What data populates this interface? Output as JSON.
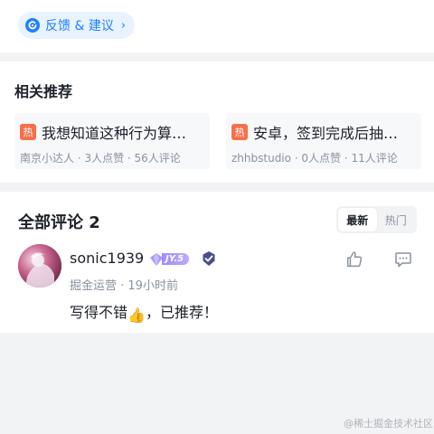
{
  "feedback": {
    "label": "反馈 & 建议",
    "chevron": "›",
    "icon": "feedback-icon"
  },
  "recommend": {
    "title": "相关推荐",
    "items": [
      {
        "badge": "热",
        "title": "我想知道这种行为算…",
        "meta": "南京小达人 · 3人点赞 · 56人评论"
      },
      {
        "badge": "热",
        "title": "安卓，签到完成后抽…",
        "meta": "zhhbstudio · 0人点赞 · 11人评论"
      }
    ]
  },
  "comments": {
    "title": "全部评论 2",
    "sort": {
      "options": [
        "最新",
        "热门"
      ],
      "selected": "最新"
    },
    "list": [
      {
        "user": "sonic1939",
        "level": "JY.5",
        "meta": "掘金运营 · 19小时前",
        "text_before": "写得不错",
        "emoji": "👍",
        "text_after": "，已推荐！"
      }
    ]
  },
  "watermark": "@稀土掘金技术社区",
  "colors": {
    "accent": "#1e80ff",
    "hot": "#f76f4a",
    "muted": "#8a919f",
    "level": "#9d8cff"
  }
}
